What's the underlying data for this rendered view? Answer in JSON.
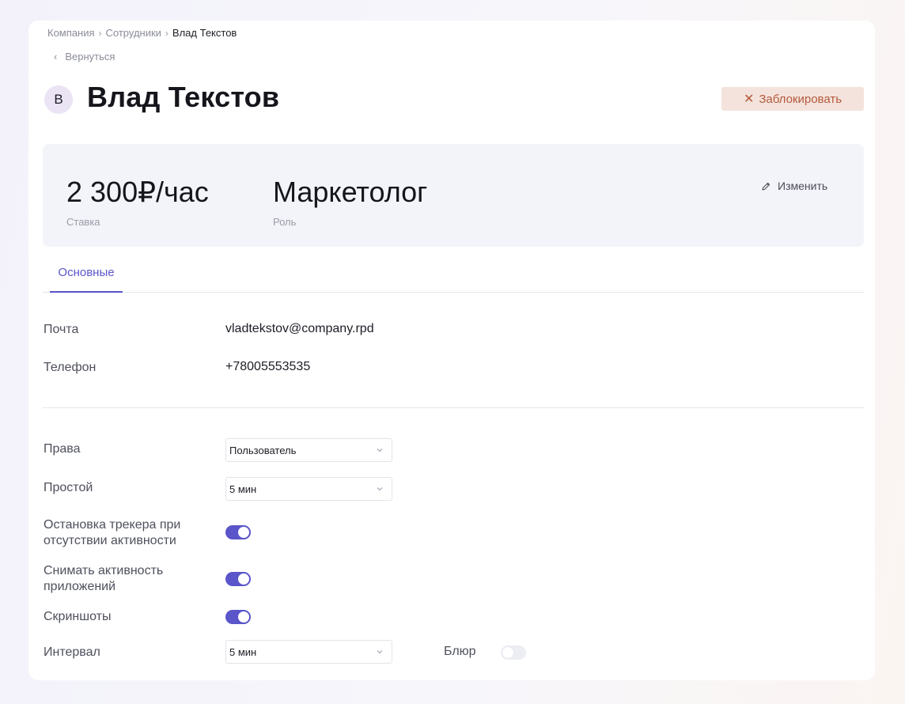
{
  "breadcrumb": {
    "items": [
      "Компания",
      "Сотрудники",
      "Влад Текстов"
    ],
    "separator": ">"
  },
  "back": {
    "label": "Вернуться"
  },
  "profile": {
    "avatar_letter": "В",
    "name": "Влад Текстов"
  },
  "actions": {
    "block_label": "Заблокировать"
  },
  "summary": {
    "rate_value": "2 300₽/час",
    "rate_label": "Ставка",
    "role_value": "Маркетолог",
    "role_label": "Роль",
    "edit_label": "Изменить"
  },
  "tabs": [
    {
      "label": "Основные",
      "active": true
    }
  ],
  "contacts": {
    "email_label": "Почта",
    "email_value": "vladtekstov@company.rpd",
    "phone_label": "Телефон",
    "phone_value": "+78005553535"
  },
  "settings": {
    "rights_label": "Права",
    "rights_value": "Пользователь",
    "idle_label": "Простой",
    "idle_value": "5 мин",
    "stop_tracker_label_line1": "Остановка трекера при",
    "stop_tracker_label_line2": "отсутствии активности",
    "stop_tracker_on": true,
    "app_activity_label_line1": "Снимать активность",
    "app_activity_label_line2": "приложений",
    "app_activity_on": true,
    "screenshots_label": "Скриншоты",
    "screenshots_on": true,
    "interval_label": "Интервал",
    "interval_value": "5 мин",
    "blur_label": "Блюр",
    "blur_on": false
  },
  "colors": {
    "accent": "#5a55c9",
    "danger_bg": "#f4e3dc",
    "danger_text": "#b35a3c",
    "panel_bg": "#f3f4f9"
  },
  "icons": {
    "breadcrumb_separator": "chevron-right-icon",
    "back": "chevron-left-icon",
    "block": "close-icon",
    "edit": "pencil-icon",
    "select": "chevron-down-icon"
  }
}
